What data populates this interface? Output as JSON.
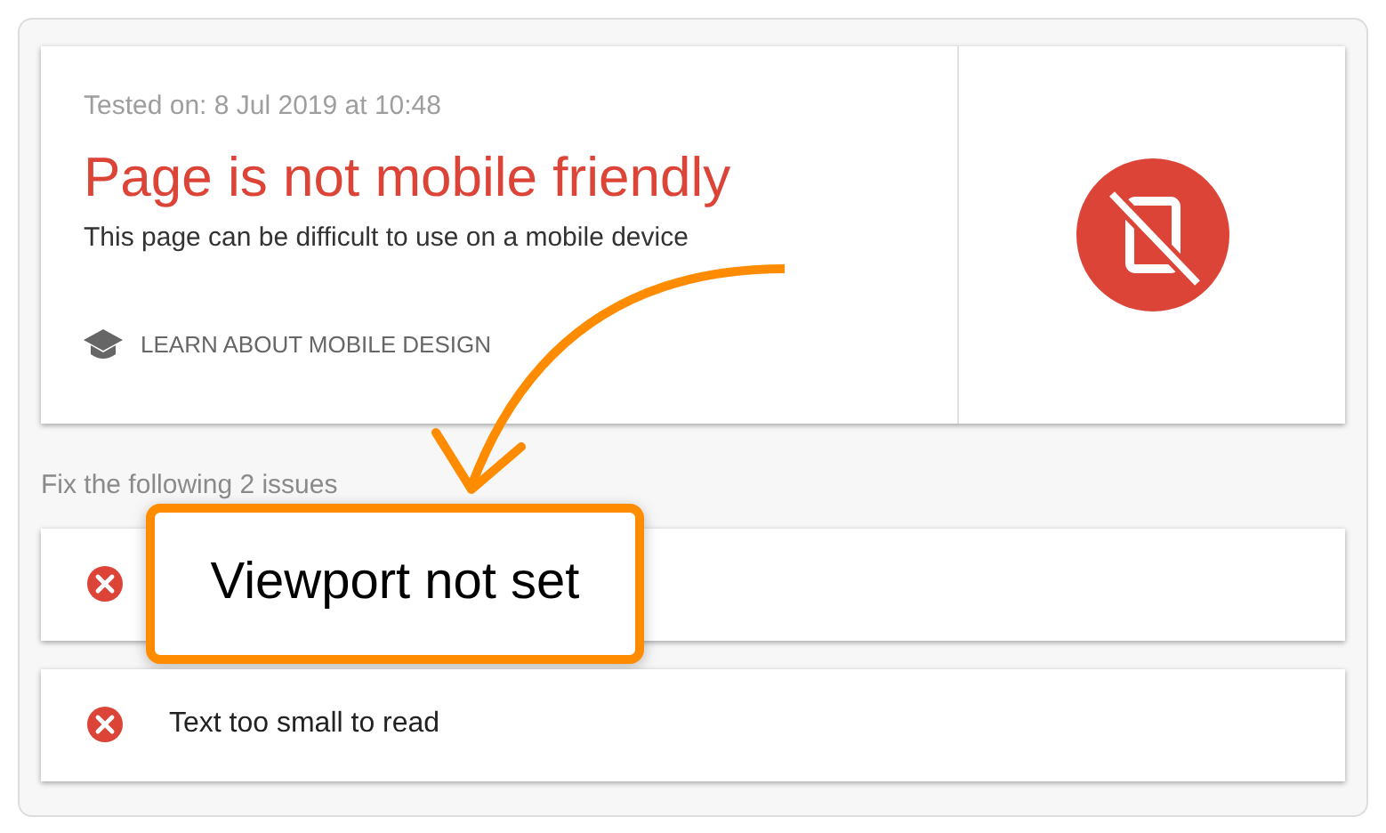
{
  "result": {
    "tested_on": "Tested on: 8 Jul 2019 at 10:48",
    "title": "Page is not mobile friendly",
    "description": "This page can be difficult to use on a mobile device",
    "link": "LEARN ABOUT MOBILE DESIGN"
  },
  "issues_heading": "Fix the following 2 issues",
  "issues": [
    {
      "kind": "callout",
      "text": "Viewport not set"
    },
    {
      "kind": "plain",
      "text": "Text too small to read"
    }
  ]
}
